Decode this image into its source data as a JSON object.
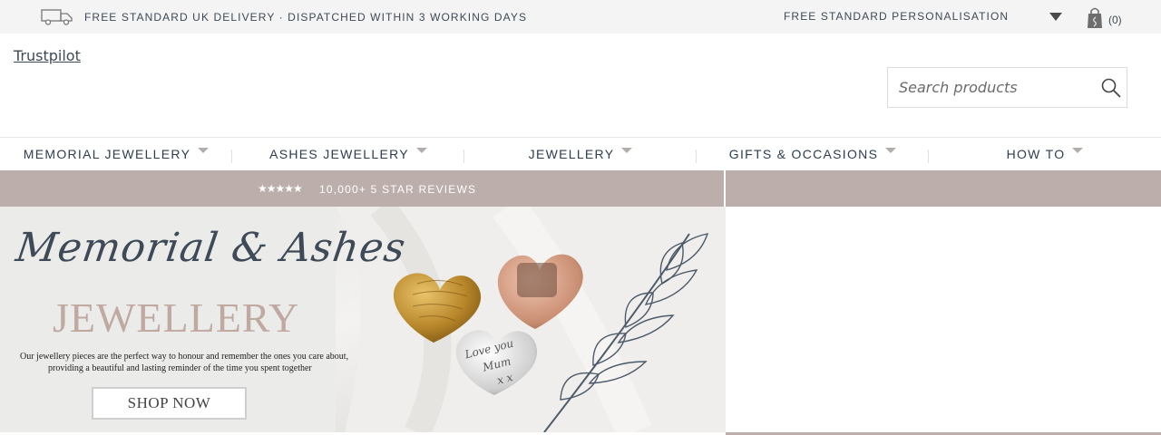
{
  "topbar": {
    "delivery_text": "FREE STANDARD UK DELIVERY · DISPATCHED WITHIN 3 WORKING DAYS",
    "personalisation_text": "FREE STANDARD PERSONALISATION",
    "bag_count": "(0)",
    "icons": [
      "truck-icon",
      "chevron-down-icon",
      "shopping-bag-icon"
    ]
  },
  "header": {
    "trustpilot_link": "Trustpilot",
    "search_placeholder": "Search products",
    "search_icon": "search-icon"
  },
  "nav": {
    "items": [
      {
        "label": "MEMORIAL JEWELLERY"
      },
      {
        "label": "ASHES JEWELLERY"
      },
      {
        "label": "JEWELLERY"
      },
      {
        "label": "GIFTS & OCCASIONS"
      },
      {
        "label": "HOW TO"
      }
    ]
  },
  "reviews": {
    "stars": "★★★★★",
    "text": "10,000+ 5 STAR REVIEWS"
  },
  "hero": {
    "script_title": "Memorial & Ashes",
    "main_title": "JEWELLERY",
    "desc_line1": "Our jewellery pieces are the perfect way to honour and remember the ones you care about,",
    "desc_line2": "providing a beautiful and lasting reminder of the time you spent together",
    "cta": "SHOP NOW",
    "heart_engraving": [
      "Love you",
      "Mum",
      "x x"
    ]
  },
  "colors": {
    "banner": "#bcaeab",
    "topbar_bg": "#f4f4f4",
    "nav_text": "#2c3e50",
    "title_accent": "#bfa9a1"
  }
}
